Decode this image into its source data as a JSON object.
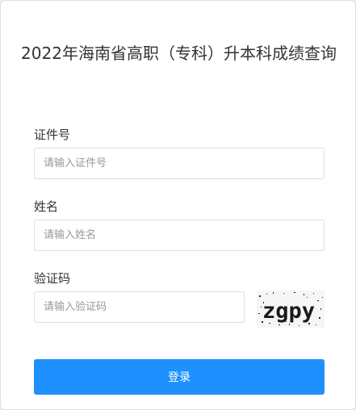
{
  "title": "2022年海南省高职（专科）升本科成绩查询",
  "form": {
    "id_label": "证件号",
    "id_placeholder": "请输入证件号",
    "name_label": "姓名",
    "name_placeholder": "请输入姓名",
    "code_label": "验证码",
    "code_placeholder": "请输入验证码",
    "captcha_text": "zgpy"
  },
  "actions": {
    "login_label": "登录"
  },
  "colors": {
    "primary": "#1e90ff",
    "text": "#333333",
    "border": "#dcdfe6"
  }
}
